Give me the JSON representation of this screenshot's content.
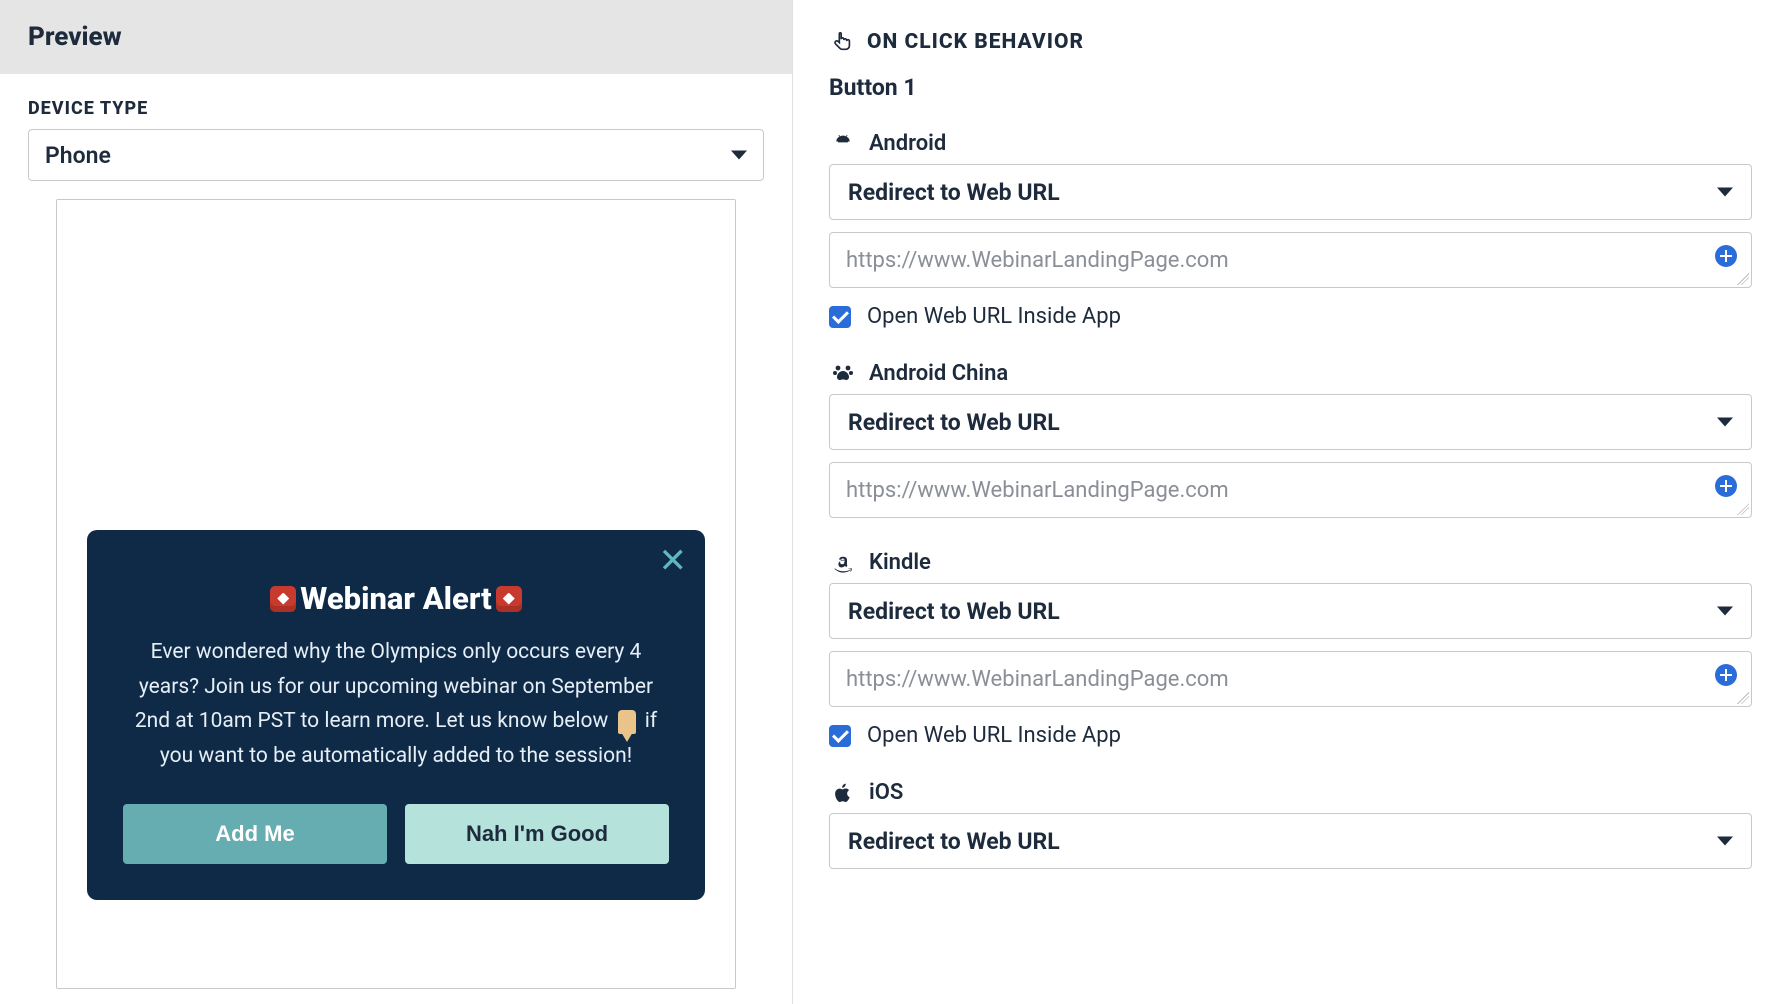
{
  "preview": {
    "title": "Preview",
    "device_type_label": "DEVICE TYPE",
    "device_type_value": "Phone",
    "modal": {
      "title": "Webinar Alert",
      "body_before": "Ever wondered why the Olympics only occurs every 4 years? Join us for our upcoming webinar on September 2nd at 10am PST to learn more. Let us know below ",
      "body_after": " if you want to be automatically added to the session!",
      "button1": "Add Me",
      "button2": "Nah I'm Good"
    }
  },
  "behavior": {
    "section_title": "ON CLICK BEHAVIOR",
    "button_heading": "Button 1",
    "platforms": [
      {
        "key": "android",
        "name": "Android",
        "action": "Redirect to Web URL",
        "url": "https://www.WebinarLandingPage.com",
        "open_inside_label": "Open Web URL Inside App",
        "open_inside_checked": true,
        "show_checkbox": true
      },
      {
        "key": "android-china",
        "name": "Android China",
        "action": "Redirect to Web URL",
        "url": "https://www.WebinarLandingPage.com",
        "show_checkbox": false
      },
      {
        "key": "kindle",
        "name": "Kindle",
        "action": "Redirect to Web URL",
        "url": "https://www.WebinarLandingPage.com",
        "open_inside_label": "Open Web URL Inside App",
        "open_inside_checked": true,
        "show_checkbox": true
      },
      {
        "key": "ios",
        "name": "iOS",
        "action": "Redirect to Web URL",
        "show_checkbox": false,
        "no_url": true
      }
    ]
  }
}
